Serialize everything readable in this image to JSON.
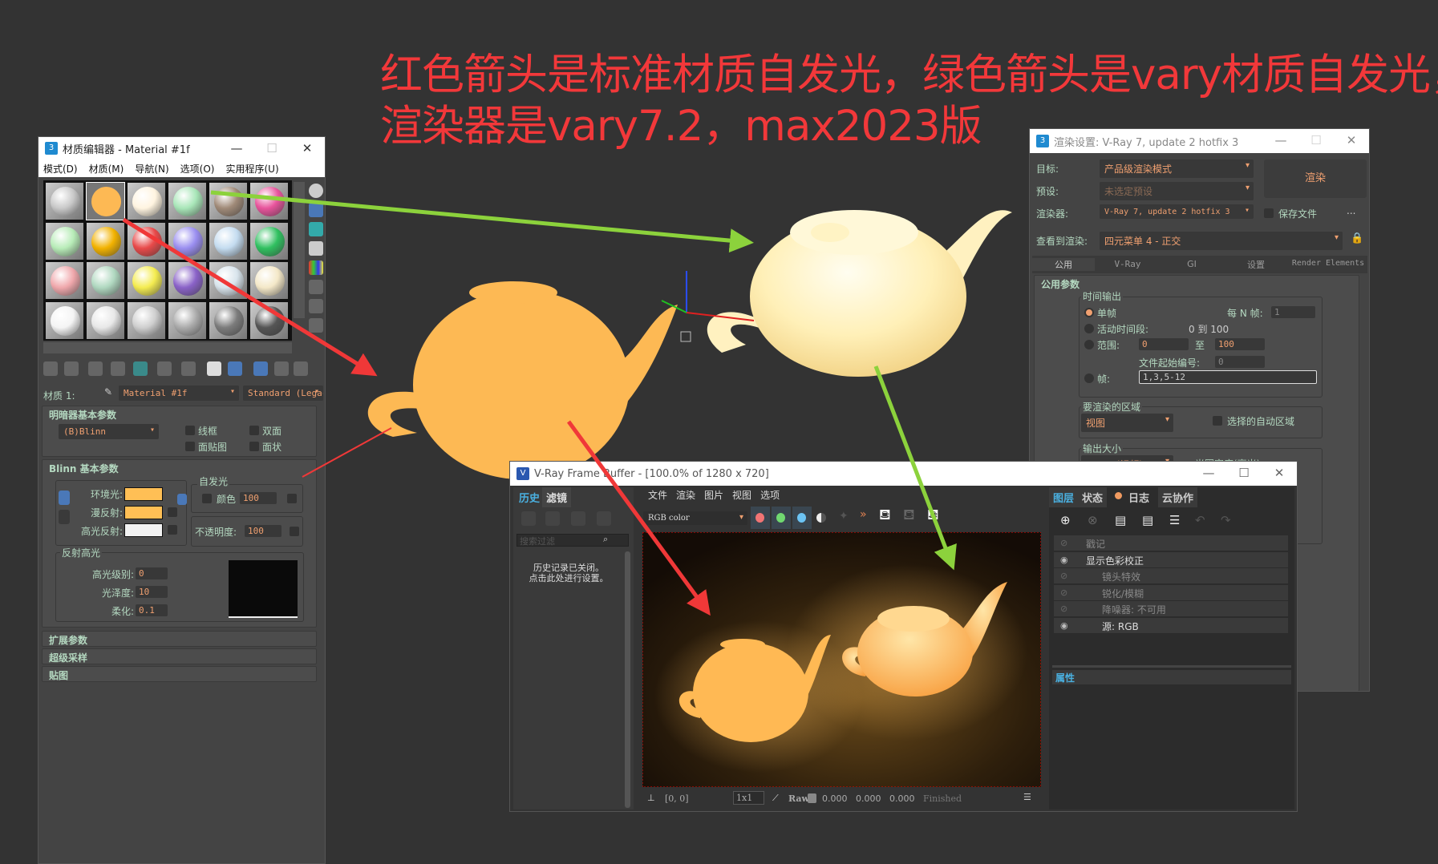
{
  "annotation": {
    "line1": "红色箭头是标准材质自发光，绿色箭头是vary材质自发光，",
    "line2": "渲染器是vary7.2，max2023版",
    "color": "#f2383a"
  },
  "material_editor": {
    "title": "材质编辑器 - Material #1f",
    "logo": "3",
    "menu": [
      "模式(D)",
      "材质(M)",
      "导航(N)",
      "选项(O)",
      "实用程序(U)"
    ],
    "slots": [
      "#c9c9c9",
      "#fdb954",
      "#fff4e0",
      "#a8e6b8",
      "#a08a78",
      "#e8549c",
      "#b8ecb8",
      "#f2b200",
      "#e84a4a",
      "#9a8ef0",
      "#c4dcf0",
      "#30c060",
      "#f0a8ac",
      "#b0d8c0",
      "#f4ec50",
      "#8a62c8",
      "#d8e4ec",
      "#f4e8c8",
      "#f4f4f4",
      "#e8e8e8",
      "#cfcfcf",
      "#ababab",
      "#7c7c7c",
      "#555555"
    ],
    "material_label": "材质 1:",
    "material_name": "Material #1f",
    "material_type": "Standard (Legac",
    "shader_rollout": {
      "title": "明暗器基本参数",
      "shader": "(B)Blinn",
      "wire": "线框",
      "two_sided": "双面",
      "face_map": "面贴图",
      "faceted": "面状"
    },
    "blinn_rollout": {
      "title": "Blinn 基本参数",
      "ambient": "环境光:",
      "diffuse": "漫反射:",
      "specular": "高光反射:",
      "self_illum_group": "自发光",
      "self_illum_color": "颜色",
      "self_illum_value": "100",
      "opacity_label": "不透明度:",
      "opacity_value": "100",
      "ambient_color": "#ffbf55",
      "diffuse_color": "#ffbf55",
      "specular_color": "#f2f2f2",
      "highlights_group": "反射高光",
      "spec_level_label": "高光级别:",
      "spec_level": "0",
      "gloss_label": "光泽度:",
      "gloss": "10",
      "soften_label": "柔化:",
      "soften": "0.1"
    },
    "rollouts": [
      "扩展参数",
      "超级采样",
      "贴图"
    ]
  },
  "render_settings": {
    "title": "渲染设置: V-Ray 7, update 2 hotfix 3",
    "target_label": "目标:",
    "target": "产品级渲染模式",
    "preset_label": "预设:",
    "preset": "未选定预设",
    "renderer_label": "渲染器:",
    "renderer": "V-Ray 7, update 2 hotfix 3",
    "save_file": "保存文件",
    "more": "...",
    "view_label": "查看到渲染:",
    "view": "四元菜单 4 - 正交",
    "render_button": "渲染",
    "tabs": [
      "公用",
      "V-Ray",
      "GI",
      "设置",
      "Render Elements"
    ],
    "rollout_title": "公用参数",
    "time_output": {
      "title": "时间输出",
      "single": "单帧",
      "every_n": "每 N 帧:",
      "every_n_value": "1",
      "active": "活动时间段:",
      "active_range": "0 到 100",
      "range": "范围:",
      "range_from": "0",
      "to": "至",
      "range_to": "100",
      "file_start": "文件起始编号:",
      "file_start_value": "0",
      "frames": "帧:",
      "frames_value": "1,3,5-12"
    },
    "area": {
      "title": "要渲染的区域",
      "value": "视图",
      "auto_region": "选择的自动区域"
    },
    "output_size": {
      "title": "输出大小",
      "preset": "HDTV (视频)",
      "aperture": "光圈宽度(毫米):"
    }
  },
  "vfb": {
    "title": "V-Ray Frame Buffer - [100.0% of 1280 x 720]",
    "left_tabs": [
      "历史",
      "滤镜"
    ],
    "search_placeholder": "搜索过滤",
    "history_msg1": "历史记录已关闭。",
    "history_msg2": "点击此处进行设置。",
    "menu": [
      "文件",
      "渲染",
      "图片",
      "视图",
      "选项"
    ],
    "channel": "RGB color",
    "status": {
      "coords": "[0, 0]",
      "zoom": "1x1",
      "raw": "Raw",
      "r": "0.000",
      "g": "0.000",
      "b": "0.000",
      "state": "Finished"
    },
    "right_tabs": [
      "图层",
      "状态",
      "日志",
      "云协作"
    ],
    "layers": [
      {
        "name": "戳记",
        "on": false,
        "indent": false
      },
      {
        "name": "显示色彩校正",
        "on": true,
        "indent": false
      },
      {
        "name": "镜头特效",
        "on": false,
        "indent": true
      },
      {
        "name": "锐化/模糊",
        "on": false,
        "indent": true
      },
      {
        "name": "降噪器: 不可用",
        "on": false,
        "indent": true
      },
      {
        "name": "源:  RGB",
        "on": true,
        "indent": true
      }
    ],
    "properties": "属性"
  }
}
